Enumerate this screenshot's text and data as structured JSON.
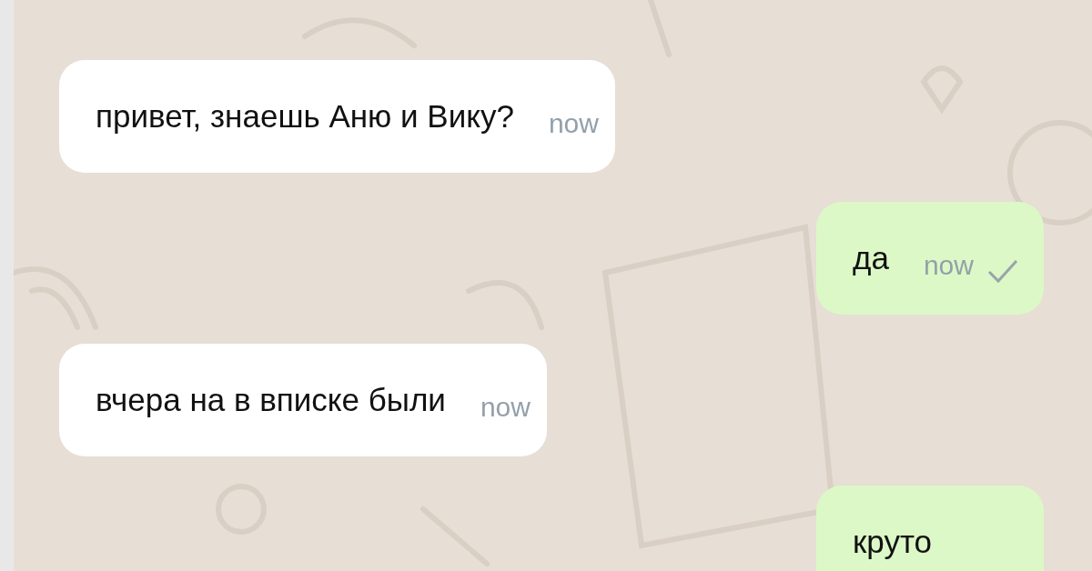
{
  "messages": [
    {
      "text": "привет, знаешь Аню и Вику?",
      "time": "now",
      "outgoing": false
    },
    {
      "text": "да",
      "time": "now",
      "outgoing": true,
      "checked": true
    },
    {
      "text": "вчера на в вписке были",
      "time": "now",
      "outgoing": false
    },
    {
      "text": "круто",
      "outgoing": true
    }
  ]
}
